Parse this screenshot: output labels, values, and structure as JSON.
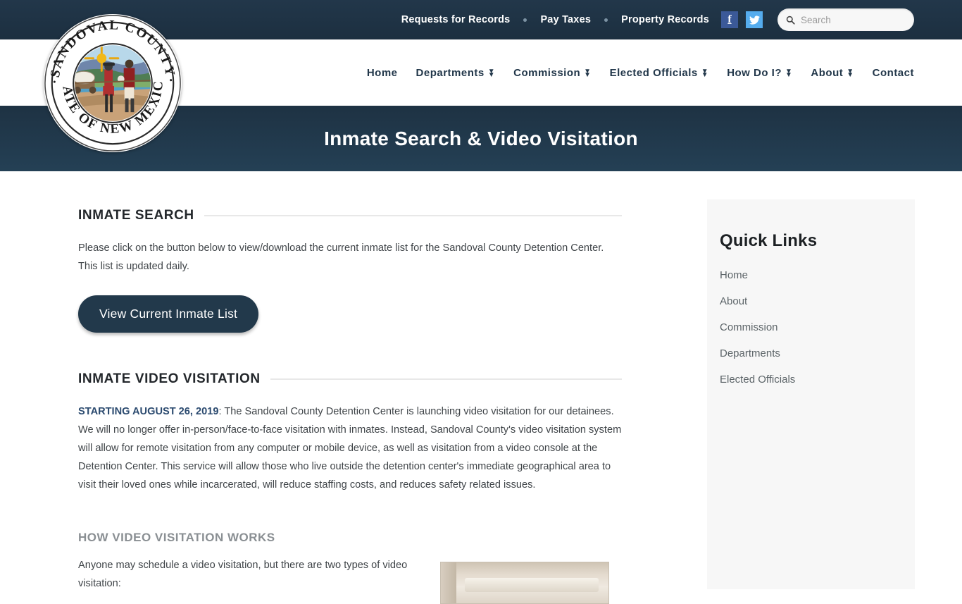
{
  "topbar": {
    "links": [
      {
        "label": "Requests for Records"
      },
      {
        "label": "Pay Taxes"
      },
      {
        "label": "Property Records"
      }
    ],
    "social": [
      {
        "name": "facebook-icon",
        "glyph": "f",
        "color": "#3b5998"
      },
      {
        "name": "twitter-icon",
        "glyph": "",
        "color": "#55acee"
      }
    ],
    "search": {
      "placeholder": "Search",
      "value": "",
      "icon": "search-icon"
    }
  },
  "nav": {
    "items": [
      {
        "label": "Home",
        "has_dropdown": false
      },
      {
        "label": "Departments",
        "has_dropdown": true
      },
      {
        "label": "Commission",
        "has_dropdown": true
      },
      {
        "label": "Elected Officials",
        "has_dropdown": true
      },
      {
        "label": "How Do I?",
        "has_dropdown": true
      },
      {
        "label": "About",
        "has_dropdown": true
      },
      {
        "label": "Contact",
        "has_dropdown": false
      }
    ]
  },
  "logo": {
    "name": "sandoval-county-seal",
    "top_text": "SANDOVAL COUNTY",
    "bottom_text": "STATE OF NEW MEXICO"
  },
  "banner": {
    "title": "Inmate Search & Video Visitation"
  },
  "sections": {
    "inmate_search": {
      "heading": "INMATE SEARCH",
      "body": "Please click on the button below to view/download the current inmate list for the Sandoval County Detention Center. This list is updated daily.",
      "button_label": "View Current Inmate List"
    },
    "video_visitation": {
      "heading": "INMATE VIDEO VISITATION",
      "lead_bold": "STARTING AUGUST 26, 2019",
      "lead_rest": ": The Sandoval County Detention Center is launching video visitation for our detainees. We will no longer offer in-person/face-to-face visitation with inmates. Instead, Sandoval County's video visitation system will allow for remote visitation from any computer or mobile device, as well as visitation from a video console at the Detention Center. This service will allow those who live outside the detention center's immediate geographical area to visit their loved ones while incarcerated, will reduce staffing costs, and reduces safety related issues."
    },
    "how_it_works": {
      "heading": "HOW VIDEO VISITATION WORKS",
      "body": "Anyone may schedule a video visitation, but there are two types of video visitation:",
      "image_name": "video-visitation-photo"
    }
  },
  "sidebar": {
    "title": "Quick Links",
    "items": [
      {
        "label": "Home"
      },
      {
        "label": "About"
      },
      {
        "label": "Commission"
      },
      {
        "label": "Departments"
      },
      {
        "label": "Elected Officials"
      }
    ]
  },
  "colors": {
    "navy": "#22374a",
    "banner": "#1e3243",
    "accent_blue": "#2b4a6f",
    "facebook": "#3b5998",
    "twitter": "#55acee",
    "sidebar_bg": "#f7f7f7"
  }
}
